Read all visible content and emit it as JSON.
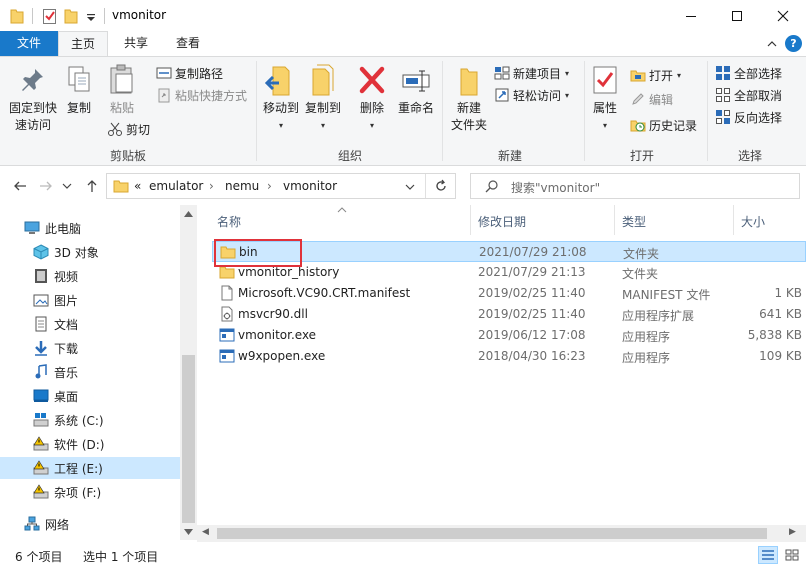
{
  "window": {
    "title": "vmonitor",
    "accent": "#1979ca"
  },
  "ribbon_tabs": {
    "file": "文件",
    "home": "主页",
    "share": "共享",
    "view": "查看"
  },
  "ribbon": {
    "clipboard": {
      "label": "剪贴板",
      "pin": "固定到快\n速访问",
      "copy": "复制",
      "paste": "粘贴",
      "copy_path": "复制路径",
      "paste_shortcut": "粘贴快捷方式",
      "cut": "剪切"
    },
    "organize": {
      "label": "组织",
      "move_to": "移动到",
      "copy_to": "复制到",
      "delete": "删除",
      "rename": "重命名"
    },
    "new": {
      "label": "新建",
      "new_folder": "新建\n文件夹",
      "new_item": "新建项目",
      "easy_access": "轻松访问"
    },
    "open": {
      "label": "打开",
      "properties": "属性",
      "open": "打开",
      "edit": "编辑",
      "history": "历史记录"
    },
    "select": {
      "label": "选择",
      "select_all": "全部选择",
      "select_none": "全部取消",
      "invert": "反向选择"
    }
  },
  "address": {
    "overflow": "«",
    "segments": [
      "emulator",
      "nemu",
      "vmonitor"
    ],
    "separator": "›",
    "search_placeholder": "搜索\"vmonitor\""
  },
  "nav_tree": [
    {
      "label": "此电脑",
      "icon": "computer-icon",
      "indent": 0,
      "selected": false
    },
    {
      "label": "3D 对象",
      "icon": "3d-objects-icon",
      "indent": 1,
      "selected": false
    },
    {
      "label": "视频",
      "icon": "video-icon",
      "indent": 1,
      "selected": false
    },
    {
      "label": "图片",
      "icon": "pictures-icon",
      "indent": 1,
      "selected": false
    },
    {
      "label": "文档",
      "icon": "documents-icon",
      "indent": 1,
      "selected": false
    },
    {
      "label": "下载",
      "icon": "download-icon",
      "indent": 1,
      "selected": false
    },
    {
      "label": "音乐",
      "icon": "music-icon",
      "indent": 1,
      "selected": false
    },
    {
      "label": "桌面",
      "icon": "desktop-icon",
      "indent": 1,
      "selected": false
    },
    {
      "label": "系统 (C:)",
      "icon": "system-drive-icon",
      "indent": 1,
      "selected": false
    },
    {
      "label": "软件 (D:)",
      "icon": "drive-warning-icon",
      "indent": 1,
      "selected": false
    },
    {
      "label": "工程 (E:)",
      "icon": "drive-warning-icon",
      "indent": 1,
      "selected": true
    },
    {
      "label": "杂项 (F:)",
      "icon": "drive-warning-icon",
      "indent": 1,
      "selected": false
    },
    {
      "label": "网络",
      "icon": "network-icon",
      "indent": 0,
      "selected": false
    }
  ],
  "columns": {
    "name": "名称",
    "modified": "修改日期",
    "type": "类型",
    "size": "大小"
  },
  "files": [
    {
      "name": "bin",
      "modified": "2021/07/29 21:08",
      "type": "文件夹",
      "size": "",
      "icon": "folder-icon",
      "selected": true
    },
    {
      "name": "vmonitor_history",
      "modified": "2021/07/29 21:13",
      "type": "文件夹",
      "size": "",
      "icon": "folder-icon",
      "selected": false
    },
    {
      "name": "Microsoft.VC90.CRT.manifest",
      "modified": "2019/02/25 11:40",
      "type": "MANIFEST 文件",
      "size": "1 KB",
      "icon": "file-icon",
      "selected": false
    },
    {
      "name": "msvcr90.dll",
      "modified": "2019/02/25 11:40",
      "type": "应用程序扩展",
      "size": "641 KB",
      "icon": "dll-icon",
      "selected": false
    },
    {
      "name": "vmonitor.exe",
      "modified": "2019/06/12 17:08",
      "type": "应用程序",
      "size": "5,838 KB",
      "icon": "exe-icon",
      "selected": false
    },
    {
      "name": "w9xpopen.exe",
      "modified": "2018/04/30 16:23",
      "type": "应用程序",
      "size": "109 KB",
      "icon": "exe-icon",
      "selected": false
    }
  ],
  "status": {
    "item_count": "6 个项目",
    "selected_count": "选中 1 个项目"
  }
}
